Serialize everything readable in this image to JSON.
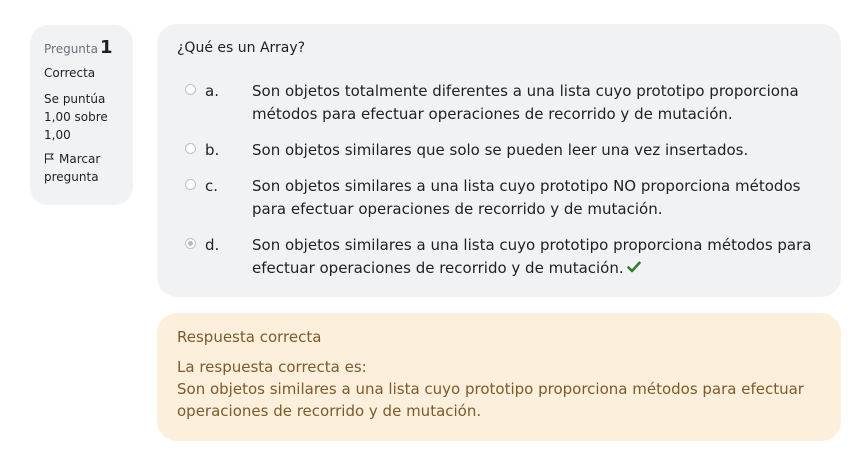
{
  "question_info": {
    "label": "Pregunta",
    "number": "1",
    "state": "Correcta",
    "grade": "Se puntúa 1,00 sobre 1,00",
    "flag_label": "Marcar pregunta",
    "flag_icon": "flag-icon"
  },
  "question": {
    "text": "¿Qué es un Array?",
    "answers": [
      {
        "letter": "a.",
        "text": "Son objetos totalmente diferentes a una lista cuyo prototipo proporciona métodos para efectuar operaciones de recorrido y de mutación.",
        "selected": false
      },
      {
        "letter": "b.",
        "text": "Son objetos similares que solo se pueden leer una vez insertados.",
        "selected": false
      },
      {
        "letter": "c.",
        "text": "Son objetos similares a una lista cuyo prototipo NO proporciona métodos para efectuar operaciones de recorrido y de mutación.",
        "selected": false
      },
      {
        "letter": "d.",
        "text": "Son objetos similares a una lista cuyo prototipo proporciona métodos para efectuar operaciones de recorrido y de mutación.",
        "selected": true,
        "correct_icon": "check-icon"
      }
    ]
  },
  "feedback": {
    "title": "Respuesta correcta",
    "intro": "La respuesta correcta es:",
    "answer": "Son objetos similares a una lista cuyo prototipo proporciona métodos para efectuar operaciones de recorrido y de mutación."
  },
  "colors": {
    "panel_bg": "#f1f2f4",
    "feedback_bg": "#fcefdc",
    "feedback_text": "#7d5a29",
    "correct_green": "#357a32"
  }
}
